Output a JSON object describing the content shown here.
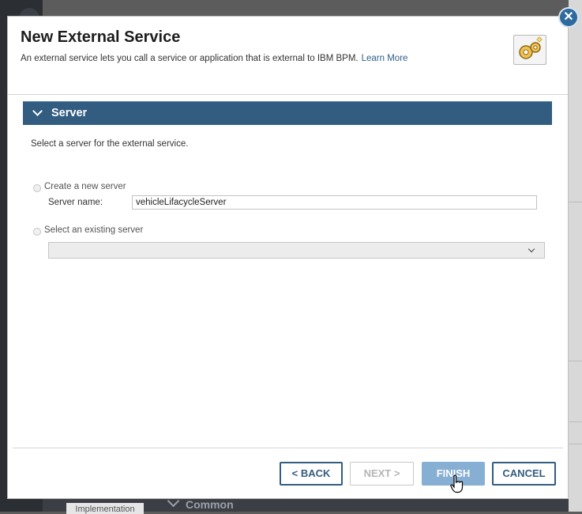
{
  "background": {
    "tab_label": "Implementation",
    "section_label": "Common"
  },
  "dialog": {
    "title": "New External Service",
    "subtitle": "An external service lets you call a service or application that is external to IBM BPM.",
    "learn_more": "Learn More",
    "header_icon": "gears-icon",
    "close_icon": "close-icon"
  },
  "section": {
    "title": "Server",
    "expanded": true,
    "description": "Select a server for the external service."
  },
  "server_options": {
    "create_new_label": "Create a new server",
    "server_name_label": "Server name:",
    "server_name_value": "vehicleLifacycleServer",
    "select_existing_label": "Select an existing server",
    "existing_server_selected": ""
  },
  "buttons": {
    "back": "< BACK",
    "next": "NEXT >",
    "finish": "FINISH",
    "cancel": "CANCEL"
  },
  "colors": {
    "section_bar": "#325c80",
    "finish_button": "#87aed3",
    "close_button": "#2f6a9e"
  }
}
